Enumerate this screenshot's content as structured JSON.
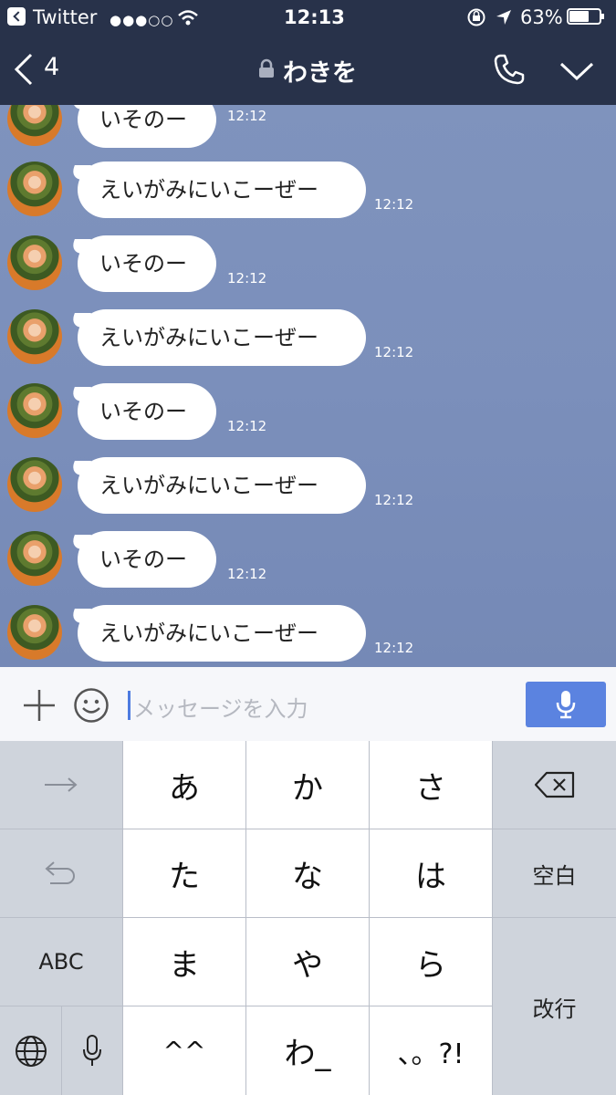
{
  "status_bar": {
    "back_app": "Twitter",
    "signal": "●●●○○",
    "time": "12:13",
    "battery": "63%"
  },
  "header": {
    "back_count": "4",
    "title": "わきを"
  },
  "messages": [
    {
      "text": "いそのー",
      "time": "12:12"
    },
    {
      "text": "えいがみにいこーぜー",
      "time": "12:12"
    },
    {
      "text": "いそのー",
      "time": "12:12"
    },
    {
      "text": "えいがみにいこーぜー",
      "time": "12:12"
    },
    {
      "text": "いそのー",
      "time": "12:12"
    },
    {
      "text": "えいがみにいこーぜー",
      "time": "12:12"
    },
    {
      "text": "いそのー",
      "time": "12:12"
    },
    {
      "text": "えいがみにいこーぜー",
      "time": "12:12"
    }
  ],
  "input": {
    "placeholder": "メッセージを入力"
  },
  "keyboard": {
    "kana": [
      "あ",
      "か",
      "さ",
      "た",
      "な",
      "は",
      "ま",
      "や",
      "ら",
      "^^",
      "わ_",
      "、。?!"
    ],
    "space": "空白",
    "enter": "改行",
    "abc": "ABC"
  },
  "colors": {
    "header_bg": "#28324a",
    "chat_bg": "#7b8fbb",
    "mic_button": "#5b83e0"
  }
}
